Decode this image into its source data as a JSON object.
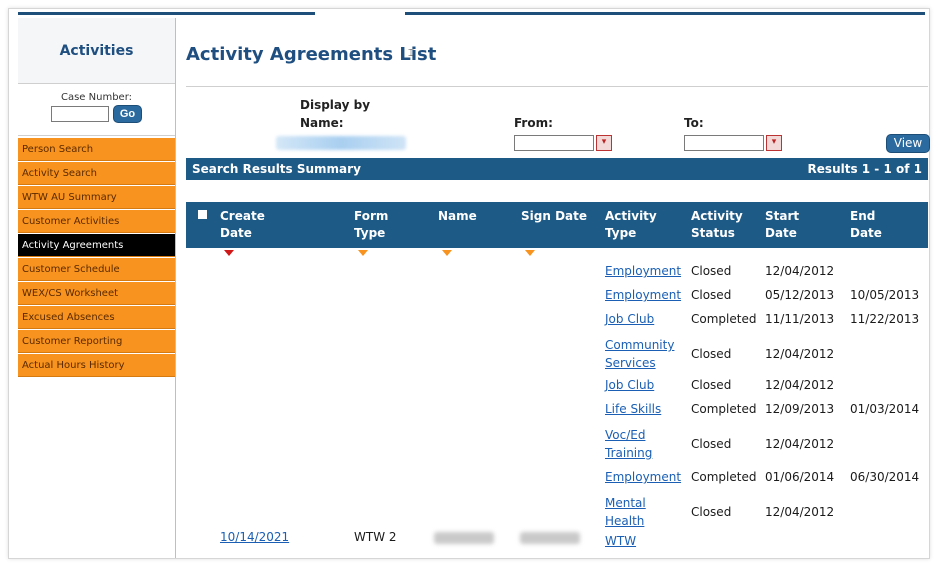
{
  "sidebar": {
    "title": "Activities",
    "case_label": "Case Number:",
    "case_value": "",
    "go_label": "Go",
    "items": [
      {
        "label": "Person Search"
      },
      {
        "label": "Activity Search"
      },
      {
        "label": "WTW AU Summary"
      },
      {
        "label": "Customer Activities"
      },
      {
        "label": "Activity Agreements",
        "active": true
      },
      {
        "label": "Customer Schedule"
      },
      {
        "label": "WEX/CS Worksheet"
      },
      {
        "label": "Excused Absences"
      },
      {
        "label": "Customer Reporting"
      },
      {
        "label": "Actual Hours History"
      }
    ]
  },
  "main": {
    "title": "Activity Agreements List",
    "display_by_label": "Display by",
    "name_label": "Name:",
    "from_label": "From:",
    "to_label": "To:",
    "from_value": "",
    "to_value": "",
    "view_label": "View",
    "summary_label": "Search Results Summary",
    "results_label": "Results 1 - 1 of 1"
  },
  "grid": {
    "headers": {
      "create_date": [
        "Create",
        "Date"
      ],
      "form_type": [
        "Form",
        "Type"
      ],
      "name": [
        "Name"
      ],
      "sign_date": [
        "Sign Date"
      ],
      "activity_type": [
        "Activity",
        "Type"
      ],
      "activity_status": [
        "Activity",
        "Status"
      ],
      "start_date": [
        "Start",
        "Date"
      ],
      "end_date": [
        "End",
        "Date"
      ]
    },
    "rows": [
      {
        "type": [
          "Employment"
        ],
        "status": "Closed",
        "start": "12/04/2012",
        "end": ""
      },
      {
        "type": [
          "Employment"
        ],
        "status": "Closed",
        "start": "05/12/2013",
        "end": "10/05/2013"
      },
      {
        "type": [
          "Job Club"
        ],
        "status": "Completed",
        "start": "11/11/2013",
        "end": "11/22/2013"
      },
      {
        "type": [
          "Community",
          "Services"
        ],
        "status": "Closed",
        "start": "12/04/2012",
        "end": ""
      },
      {
        "type": [
          "Job Club"
        ],
        "status": "Closed",
        "start": "12/04/2012",
        "end": ""
      },
      {
        "type": [
          "Life Skills"
        ],
        "status": "Completed",
        "start": "12/09/2013",
        "end": "01/03/2014"
      },
      {
        "type": [
          "Voc/Ed",
          "Training"
        ],
        "status": "Closed",
        "start": "12/04/2012",
        "end": ""
      },
      {
        "type": [
          "Employment"
        ],
        "status": "Completed",
        "start": "01/06/2014",
        "end": "06/30/2014"
      },
      {
        "type": [
          "Mental",
          "Health"
        ],
        "status": "Closed",
        "start": "12/04/2012",
        "end": ""
      },
      {
        "type": [
          "WTW"
        ],
        "status": "",
        "start": "",
        "end": ""
      }
    ],
    "record": {
      "create_date": "10/14/2021",
      "form_type": "WTW 2"
    }
  },
  "icons": {
    "calendar": "calendar-icon",
    "cursor": "text-cursor-icon",
    "check": "checkbox-icon",
    "sort": "sort-arrow-icon"
  },
  "colors": {
    "brand": "#1e5a86",
    "menu": "#f7931e",
    "menu_active": "#000000",
    "link": "#1a5fb4"
  }
}
